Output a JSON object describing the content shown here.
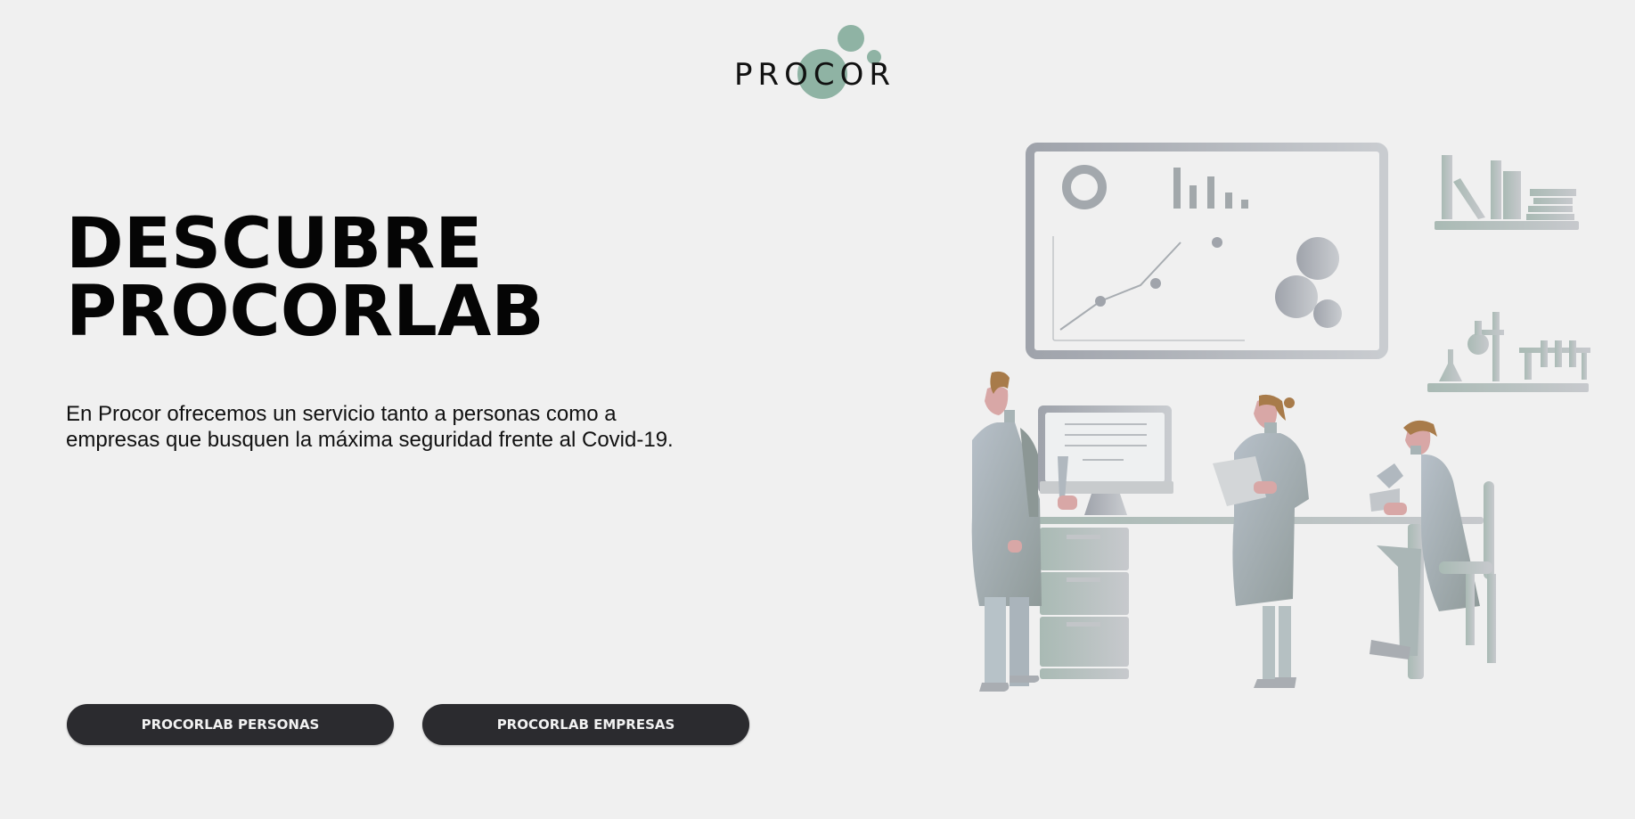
{
  "brand": {
    "name": "PROCOR",
    "accent_color": "#8fb3a4"
  },
  "hero": {
    "title_line1": "DESCUBRE",
    "title_line2": "PROCORLAB",
    "description_line1": "En Procor ofrecemos un servicio tanto a personas como a",
    "description_line2": "empresas que busquen la máxima seguridad frente al Covid-19."
  },
  "buttons": {
    "personas_label": "PROCORLAB PERSONAS",
    "empresas_label": "PROCORLAB EMPRESAS",
    "background_color": "#2b2b2f"
  },
  "illustration": {
    "icon": "laboratory-scientists-illustration"
  }
}
